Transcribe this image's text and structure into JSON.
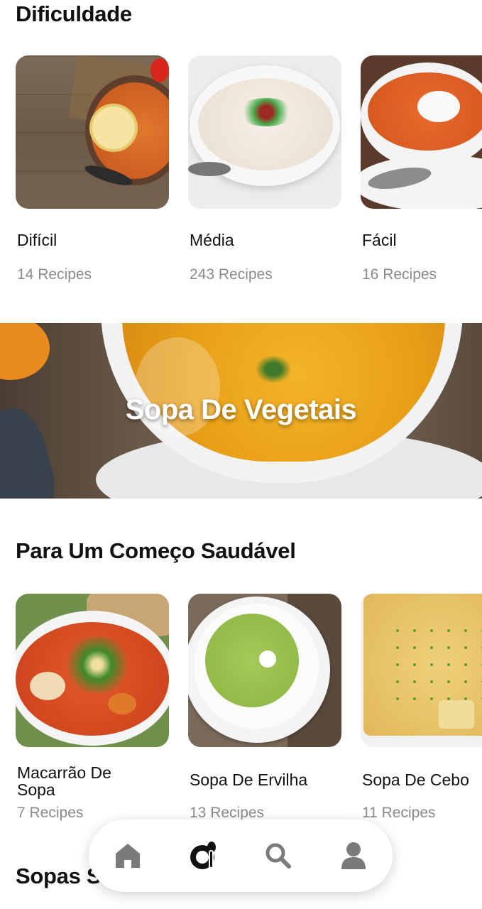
{
  "sections": {
    "difficulty": {
      "title": "Dificuldade",
      "items": [
        {
          "title": "Difícil",
          "count": "14 Recipes"
        },
        {
          "title": "Média",
          "count": "243 Recipes"
        },
        {
          "title": "Fácil",
          "count": "16 Recipes"
        }
      ]
    },
    "banner": {
      "title": "Sopa De Vegetais"
    },
    "healthy": {
      "title": "Para Um Começo Saudável",
      "items": [
        {
          "title": "Macarrão De Sopa",
          "count": "7 Recipes"
        },
        {
          "title": "Sopa De Ervilha",
          "count": "13 Recipes"
        },
        {
          "title": "Sopa De Cebo",
          "count": "11 Recipes"
        }
      ]
    },
    "next": {
      "title": "Sopas S"
    }
  },
  "nav": {
    "items": [
      {
        "icon": "home-icon"
      },
      {
        "icon": "recipes-icon"
      },
      {
        "icon": "search-icon"
      },
      {
        "icon": "profile-icon"
      }
    ]
  },
  "colors": {
    "accent": "#111111",
    "muted": "#8a8a8a",
    "nav_inactive": "#7a7a7a"
  }
}
